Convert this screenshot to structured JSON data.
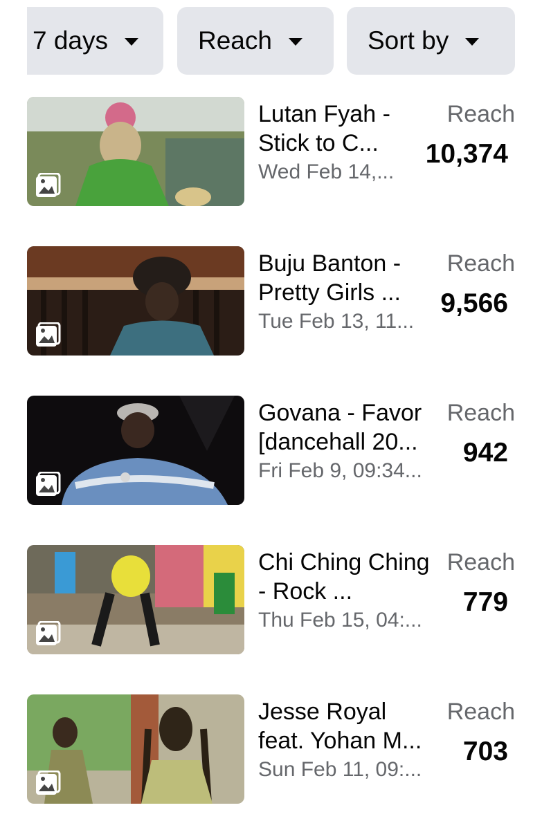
{
  "filters": {
    "range_label": "7 days",
    "metric_label": "Reach",
    "sort_label": "Sort by"
  },
  "posts": [
    {
      "title": "Lutan Fyah -\nStick to C...",
      "date": "Wed Feb 14,...",
      "metric_label": "Reach",
      "metric_value": "10,374",
      "thumb_palette": [
        "#7a8a5a",
        "#d36a8a",
        "#49a23c",
        "#c9b48a"
      ]
    },
    {
      "title": "Buju Banton -\nPretty Girls ...",
      "date": "Tue Feb 13, 11...",
      "metric_label": "Reach",
      "metric_value": "9,566",
      "thumb_palette": [
        "#6b3a22",
        "#2b1d16",
        "#3d6f7f",
        "#c7a27a"
      ]
    },
    {
      "title": "Govana - Favor\n[dancehall 20...",
      "date": "Fri Feb 9, 09:34...",
      "metric_label": "Reach",
      "metric_value": "942",
      "thumb_palette": [
        "#0e0c0e",
        "#1c1a1d",
        "#6a8fbf",
        "#b9b6b2"
      ]
    },
    {
      "title": "Chi Ching Ching\n- Rock ...",
      "date": "Thu Feb 15, 04:...",
      "metric_label": "Reach",
      "metric_value": "779",
      "thumb_palette": [
        "#3a9ad5",
        "#e8df3a",
        "#d46a7a",
        "#8a7c66"
      ]
    },
    {
      "title": "Jesse Royal\nfeat. Yohan M...",
      "date": "Sun Feb 11, 09:...",
      "metric_label": "Reach",
      "metric_value": "703",
      "thumb_palette": [
        "#7aa860",
        "#b9b39a",
        "#8c8a55",
        "#2f2518"
      ]
    }
  ]
}
